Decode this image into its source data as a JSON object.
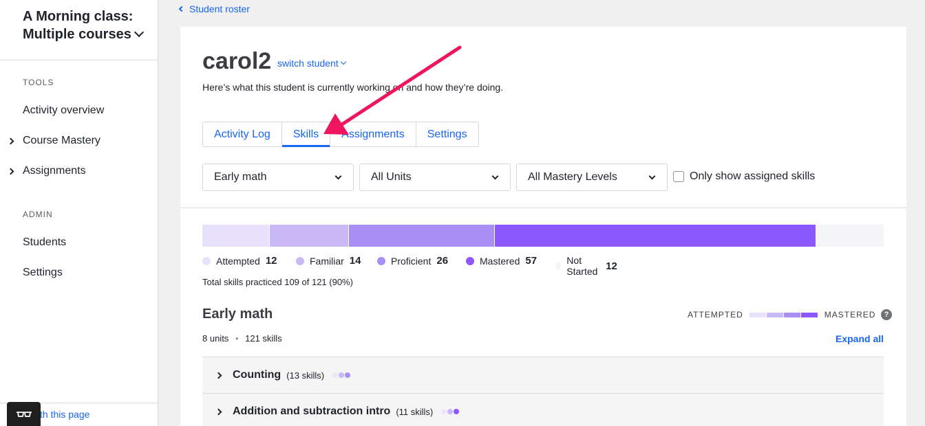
{
  "sidebar": {
    "class_title": "A Morning class: Multiple courses",
    "tools_label": "TOOLS",
    "tools": [
      {
        "label": "Activity overview",
        "expandable": false
      },
      {
        "label": "Course Mastery",
        "expandable": true
      },
      {
        "label": "Assignments",
        "expandable": true
      }
    ],
    "admin_label": "ADMIN",
    "admin": [
      {
        "label": "Students"
      },
      {
        "label": "Settings"
      }
    ],
    "help_link": "th this page"
  },
  "back_link": "Student roster",
  "student": {
    "name": "carol2",
    "switch_label": "switch student",
    "subtitle": "Here’s what this student is currently working on and how they’re doing."
  },
  "tabs": [
    {
      "label": "Activity Log",
      "active": false
    },
    {
      "label": "Skills",
      "active": true
    },
    {
      "label": "Assignments",
      "active": false
    },
    {
      "label": "Settings",
      "active": false
    }
  ],
  "filters": {
    "course": "Early math",
    "unit": "All Units",
    "mastery": "All Mastery Levels",
    "only_assigned_label": "Only show assigned skills",
    "only_assigned_checked": false
  },
  "mastery": {
    "levels": [
      {
        "label": "Attempted",
        "count": 12,
        "color": "#e7e1fb"
      },
      {
        "label": "Familiar",
        "count": 14,
        "color": "#c9b9f7"
      },
      {
        "label": "Proficient",
        "count": 26,
        "color": "#a98ff5"
      },
      {
        "label": "Mastered",
        "count": 57,
        "color": "#8c57fd"
      },
      {
        "label": "Not Started",
        "count": 12,
        "color": "#f5f5f7"
      }
    ],
    "total_text": "Total skills practiced 109 of 121 (90%)"
  },
  "course_section": {
    "title": "Early math",
    "scale_left": "ATTEMPTED",
    "scale_right": "MASTERED",
    "help_icon": "?",
    "units_label": "8 units",
    "skills_label": "121 skills",
    "expand_all": "Expand all"
  },
  "units": [
    {
      "name": "Counting",
      "count_label": "(13 skills)"
    },
    {
      "name": "Addition and subtraction intro",
      "count_label": "(11 skills)"
    }
  ],
  "colors": {
    "link": "#1865f2",
    "annotation_arrow": "#f0155f"
  }
}
